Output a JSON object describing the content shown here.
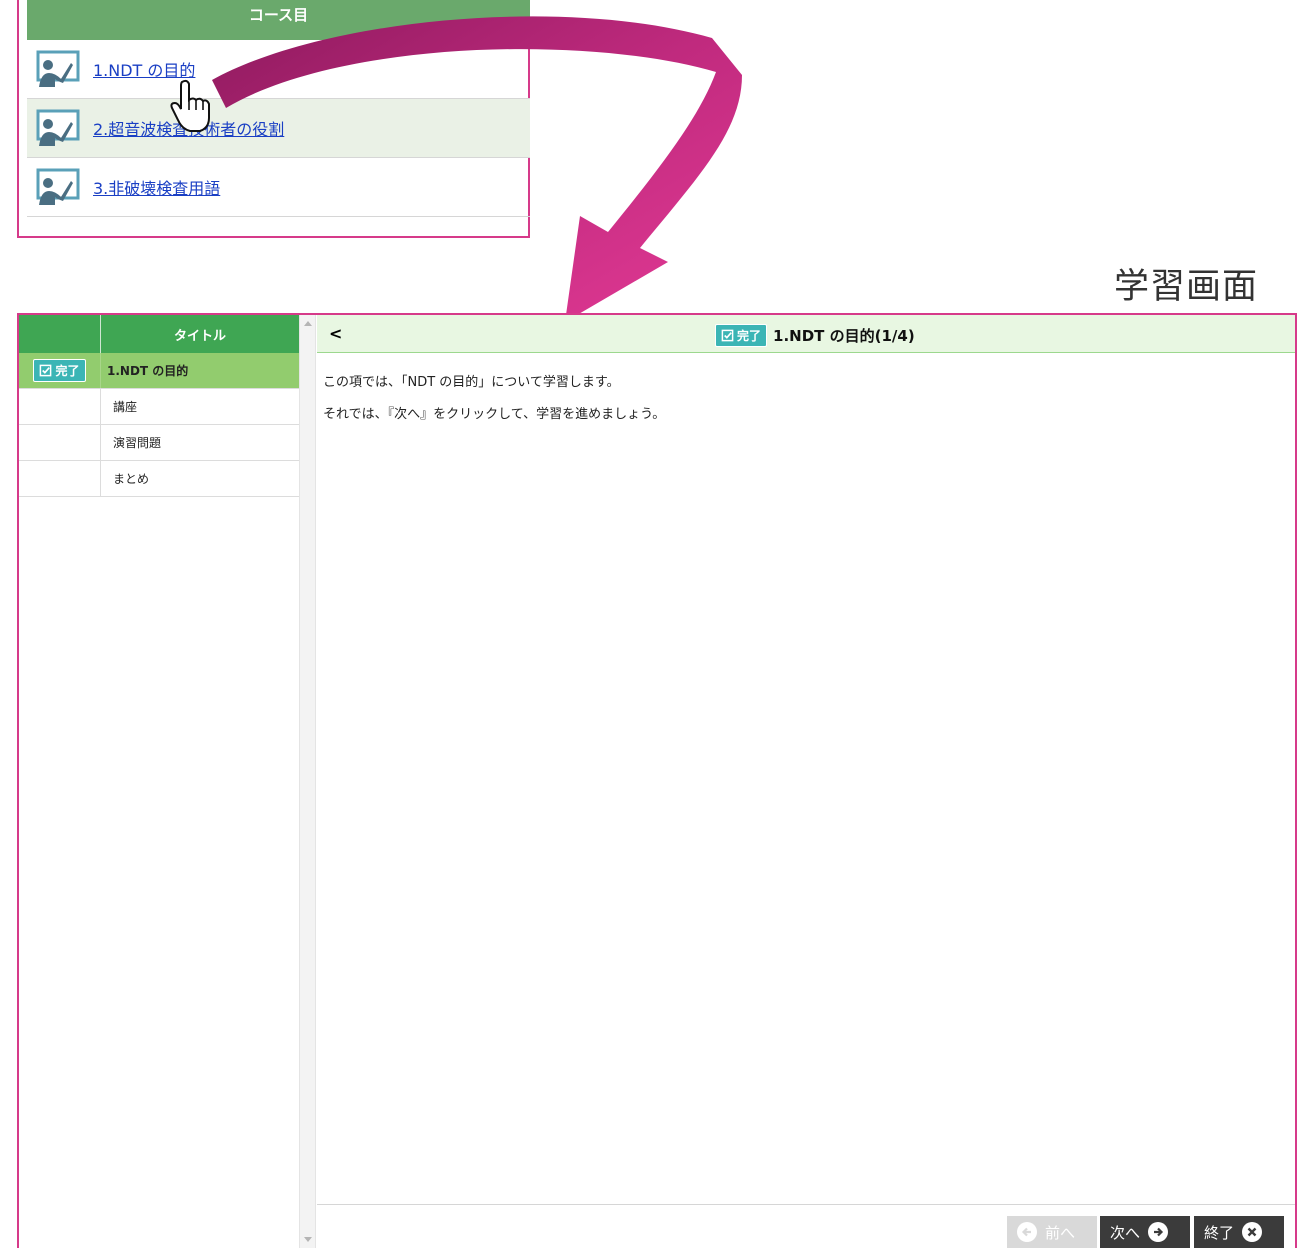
{
  "top_list": {
    "header": "コース目",
    "items": [
      {
        "label": "1.NDT の目的"
      },
      {
        "label": "2.超音波検査技術者の役割"
      },
      {
        "label": " 3.非破壊検査用語"
      }
    ]
  },
  "screen_title": "学習画面",
  "sidebar": {
    "header_title": "タイトル",
    "rows": [
      {
        "badge": "完了",
        "label": "1.NDT の目的"
      },
      {
        "badge": "",
        "label": "講座"
      },
      {
        "badge": "",
        "label": "演習問題"
      },
      {
        "badge": "",
        "label": "まとめ"
      }
    ]
  },
  "content": {
    "back_label": "<",
    "badge": "完了",
    "title": "1.NDT の目的(1/4)",
    "lines": [
      "この項では、「NDT の目的」について学習します。",
      "それでは、『次へ』をクリックして、学習を進めましょう。"
    ]
  },
  "footer": {
    "prev_label": "前へ",
    "next_label": "次へ",
    "end_label": "終了"
  },
  "colors": {
    "accent_pink": "#d63a8a",
    "header_green": "#3fa653",
    "active_green": "#92cc6e",
    "badge_teal": "#3bb5b5"
  }
}
